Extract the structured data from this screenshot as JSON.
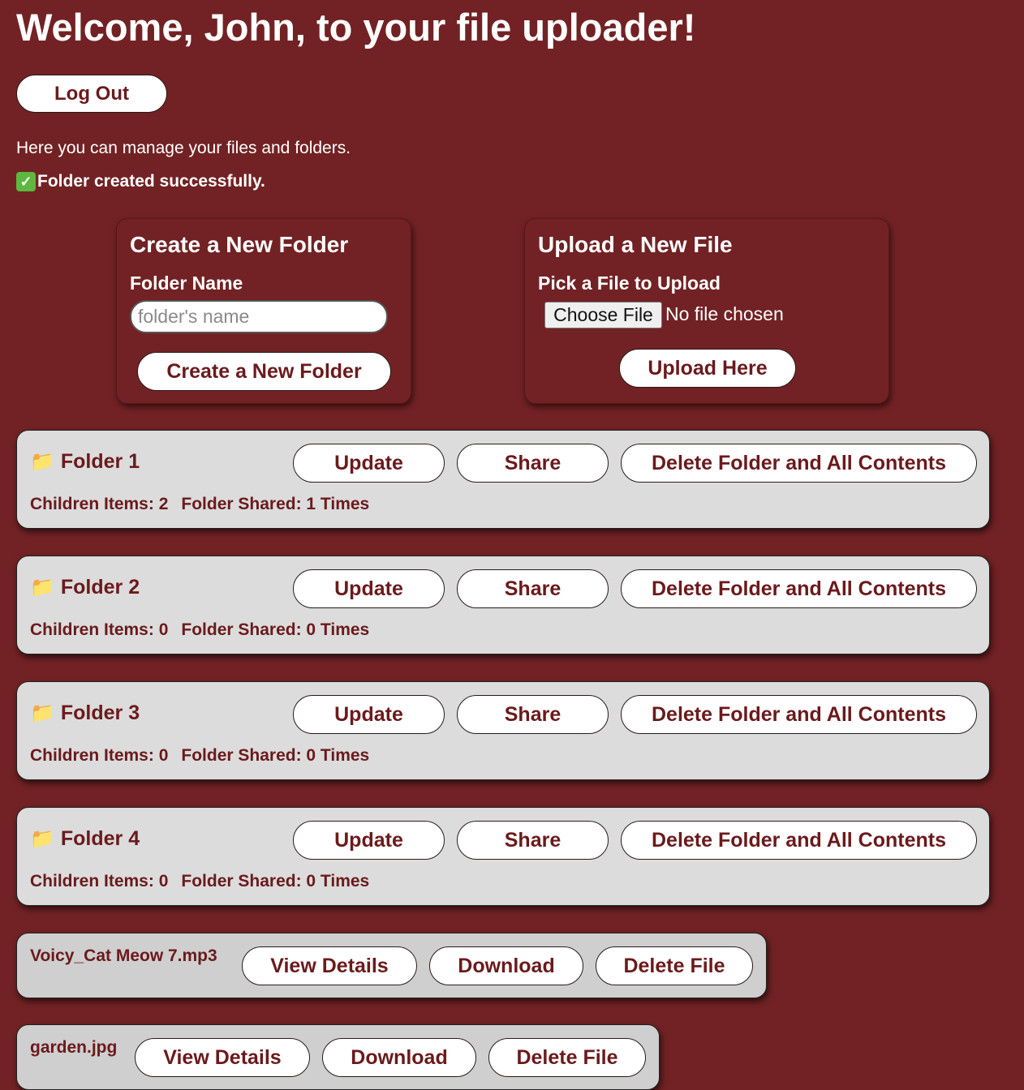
{
  "header": {
    "title": "Welcome, John, to your file uploader!"
  },
  "logout_label": "Log Out",
  "intro": "Here you can manage your files and folders.",
  "flash": {
    "icon": "check-mark-icon",
    "message": "Folder created successfully.",
    "color": "#5cb83f"
  },
  "create_folder": {
    "heading": "Create a New Folder",
    "field_label": "Folder Name",
    "placeholder": "folder's name",
    "value": "",
    "button": "Create a New Folder"
  },
  "upload_file": {
    "heading": "Upload a New File",
    "field_label": "Pick a File to Upload",
    "choose_label": "Choose File",
    "status": "No file chosen",
    "button": "Upload Here"
  },
  "folders": [
    {
      "icon": "folder-icon",
      "name": "Folder 1",
      "update": "Update",
      "share": "Share",
      "delete": "Delete Folder and All Contents",
      "children": "Children Items: 2",
      "shared": "Folder Shared: 1 Times"
    },
    {
      "icon": "folder-icon",
      "name": "Folder 2",
      "update": "Update",
      "share": "Share",
      "delete": "Delete Folder and All Contents",
      "children": "Children Items: 0",
      "shared": "Folder Shared: 0 Times"
    },
    {
      "icon": "folder-icon",
      "name": "Folder 3",
      "update": "Update",
      "share": "Share",
      "delete": "Delete Folder and All Contents",
      "children": "Children Items: 0",
      "shared": "Folder Shared: 0 Times"
    },
    {
      "icon": "folder-icon",
      "name": "Folder 4",
      "update": "Update",
      "share": "Share",
      "delete": "Delete Folder and All Contents",
      "children": "Children Items: 0",
      "shared": "Folder Shared: 0 Times"
    }
  ],
  "files": [
    {
      "name": "Voicy_Cat Meow 7.mp3",
      "details": "View Details",
      "download": "Download",
      "delete": "Delete File"
    },
    {
      "name": "garden.jpg",
      "details": "View Details",
      "download": "Download",
      "delete": "Delete File"
    }
  ],
  "colors": {
    "background": "#722224",
    "accent_text": "#6b1a1c",
    "folder_card": "#dcdcdc",
    "file_card": "#cfcfcf"
  }
}
